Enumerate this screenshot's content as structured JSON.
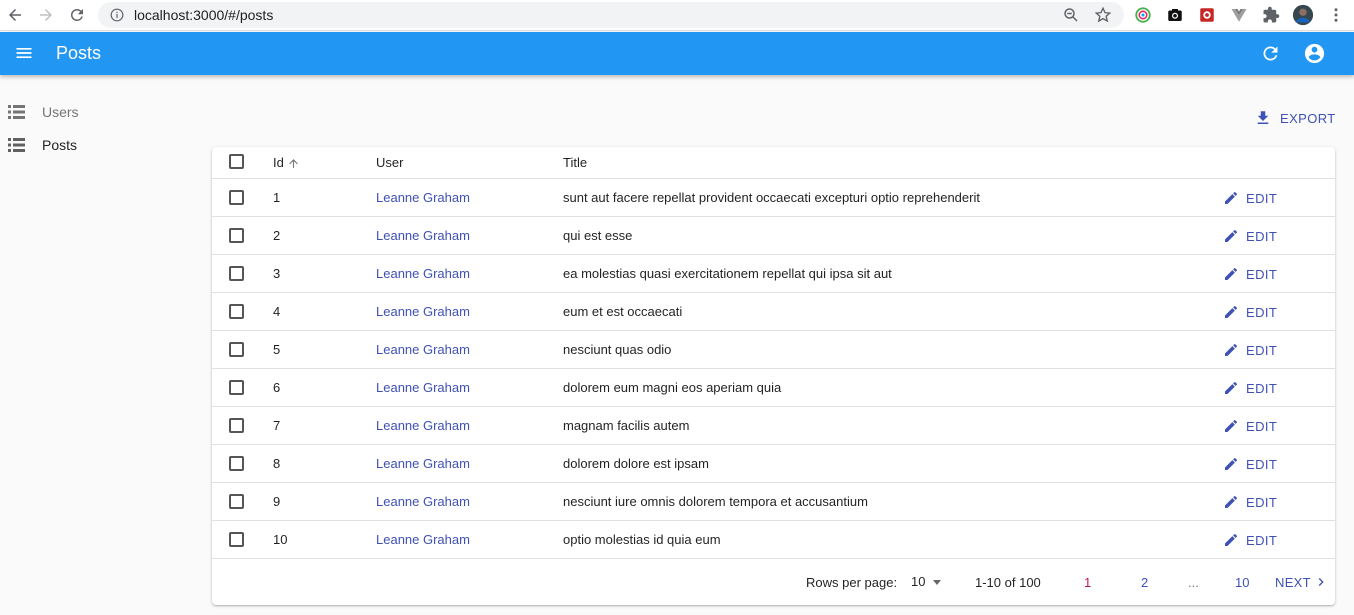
{
  "browser": {
    "url": "localhost:3000/#/posts"
  },
  "appbar": {
    "title": "Posts"
  },
  "sidebar": {
    "items": [
      {
        "label": "Users",
        "icon": "list-icon"
      },
      {
        "label": "Posts",
        "icon": "list-icon"
      }
    ]
  },
  "toolbar": {
    "export_label": "EXPORT"
  },
  "table": {
    "columns": [
      "Id",
      "User",
      "Title"
    ],
    "edit_label": "EDIT",
    "rows": [
      {
        "id": "1",
        "user": "Leanne Graham",
        "title": "sunt aut facere repellat provident occaecati excepturi optio reprehenderit"
      },
      {
        "id": "2",
        "user": "Leanne Graham",
        "title": "qui est esse"
      },
      {
        "id": "3",
        "user": "Leanne Graham",
        "title": "ea molestias quasi exercitationem repellat qui ipsa sit aut"
      },
      {
        "id": "4",
        "user": "Leanne Graham",
        "title": "eum et est occaecati"
      },
      {
        "id": "5",
        "user": "Leanne Graham",
        "title": "nesciunt quas odio"
      },
      {
        "id": "6",
        "user": "Leanne Graham",
        "title": "dolorem eum magni eos aperiam quia"
      },
      {
        "id": "7",
        "user": "Leanne Graham",
        "title": "magnam facilis autem"
      },
      {
        "id": "8",
        "user": "Leanne Graham",
        "title": "dolorem dolore est ipsam"
      },
      {
        "id": "9",
        "user": "Leanne Graham",
        "title": "nesciunt iure omnis dolorem tempora et accusantium"
      },
      {
        "id": "10",
        "user": "Leanne Graham",
        "title": "optio molestias id quia eum"
      }
    ]
  },
  "pagination": {
    "rows_per_page_label": "Rows per page:",
    "rows_per_page_value": "10",
    "range": "1-10 of 100",
    "pages": [
      "1",
      "2",
      "...",
      "10"
    ],
    "current_page": "1",
    "next_label": "NEXT"
  },
  "colors": {
    "appbar": "#2196f3",
    "link": "#3f51b5",
    "current_page": "#c2185b"
  }
}
